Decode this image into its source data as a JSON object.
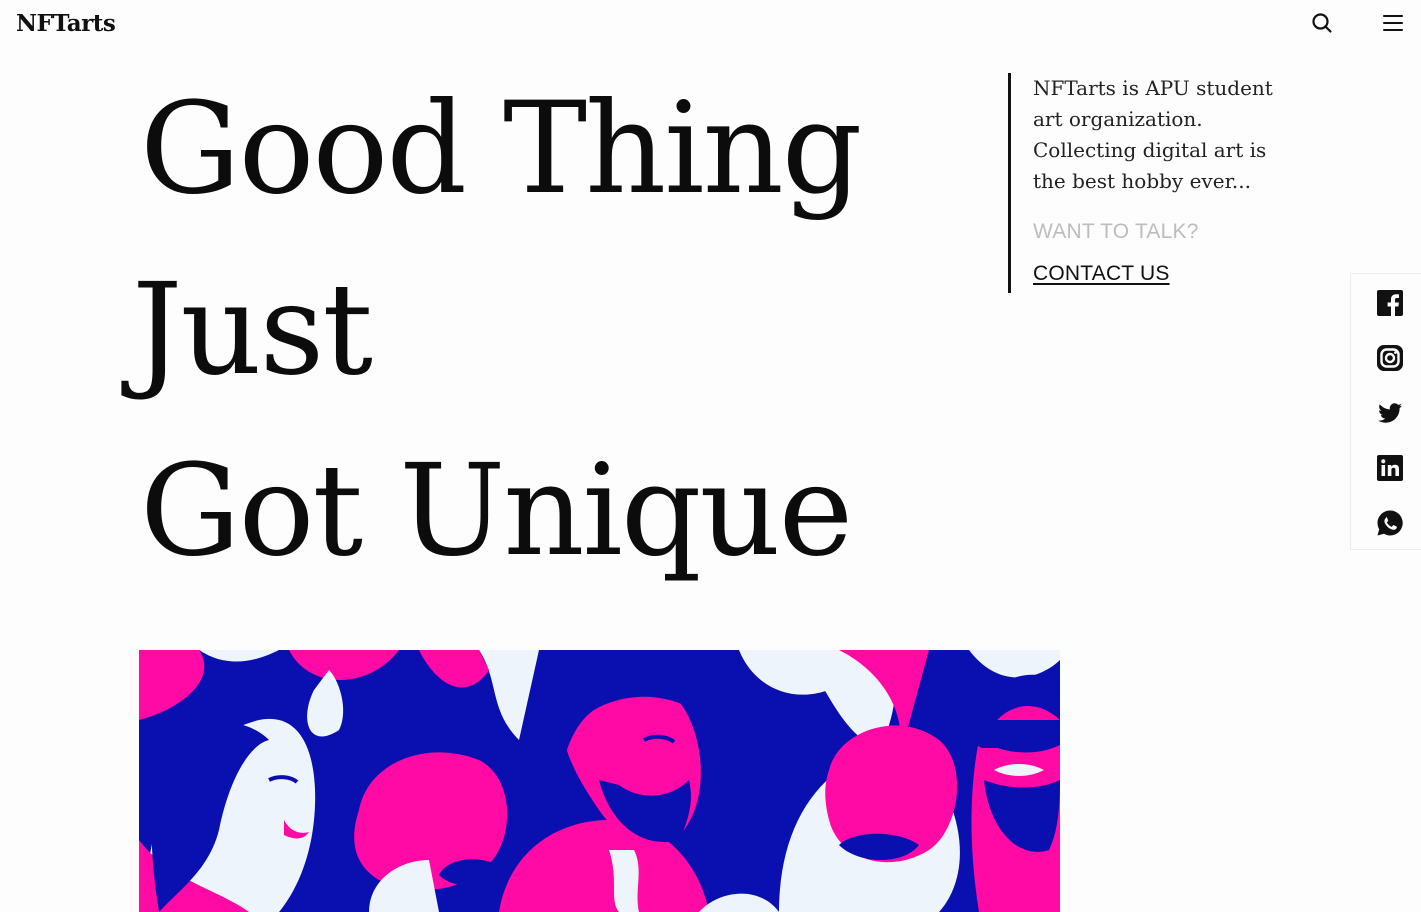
{
  "header": {
    "logo": "NFTarts",
    "search_icon": "search-icon",
    "menu_icon": "hamburger-menu-icon"
  },
  "hero": {
    "line1": "Good Thing",
    "line2": "Just",
    "line3": "Got Unique"
  },
  "intro": {
    "text": "NFTarts is APU student art organization. Collecting digital art is the best hobby ever...",
    "want_label": "WANT TO TALK?",
    "contact_label": "CONTACT US"
  },
  "social": {
    "icons": [
      "facebook-icon",
      "instagram-icon",
      "twitter-icon",
      "linkedin-icon",
      "whatsapp-icon"
    ]
  },
  "colors": {
    "background": "#fefdfd",
    "text": "#111111",
    "muted": "#bdbdbd",
    "art_blue": "#0a0fb0",
    "art_pink": "#ff0aa5",
    "art_light": "#eef4fb"
  }
}
